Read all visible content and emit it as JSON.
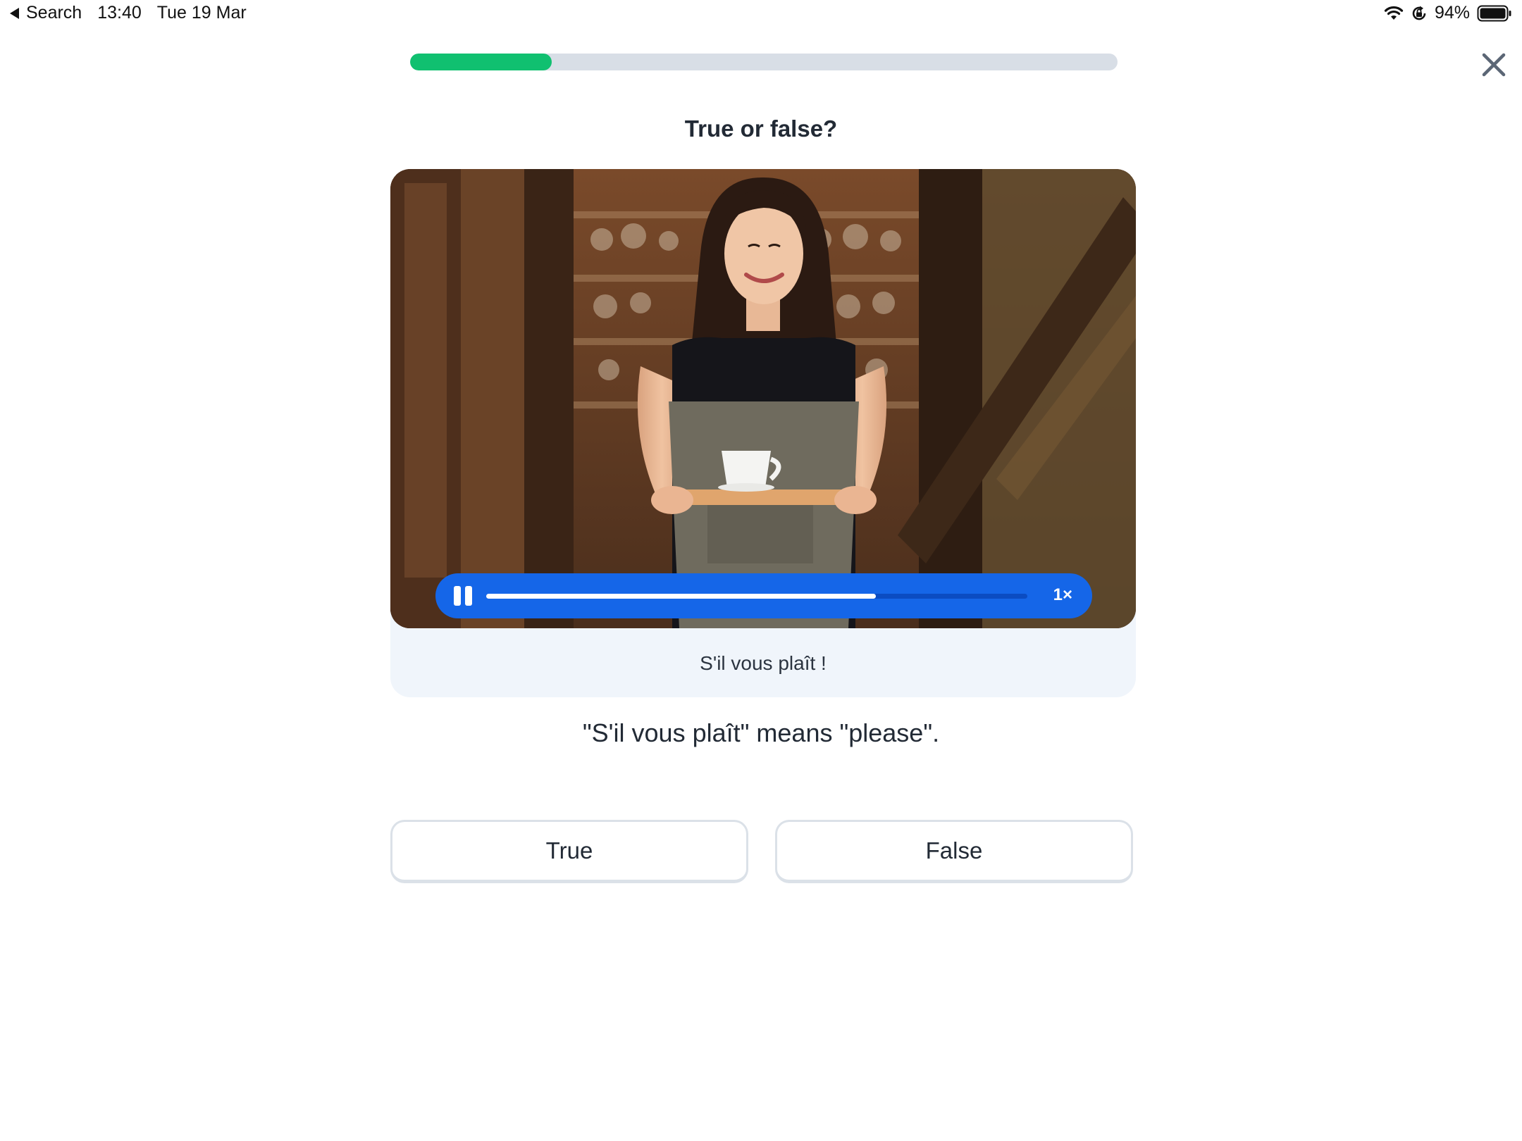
{
  "status_bar": {
    "back_label": "Search",
    "time": "13:40",
    "date": "Tue 19 Mar",
    "battery": "94%",
    "icons": [
      "back-arrow-icon",
      "wifi-icon",
      "orientation-lock-icon",
      "battery-icon"
    ]
  },
  "lesson": {
    "progress_fraction": 0.2
  },
  "question": {
    "title": "True or false?",
    "image": "photo: smiling barista in apron holding a tray with a white coffee cup, in a wooden café doorway",
    "caption": "S'il vous plaît !",
    "statement": "\"S'il vous plaît\" means \"please\"."
  },
  "player": {
    "state": "playing",
    "playback_fraction": 0.72,
    "speed_label": "1×",
    "color": "#1566e8"
  },
  "answers": [
    {
      "label": "True"
    },
    {
      "label": "False"
    }
  ],
  "colors": {
    "progress_fill": "#10c070",
    "progress_track": "#d8dee6",
    "card_background": "#f0f5fb"
  }
}
